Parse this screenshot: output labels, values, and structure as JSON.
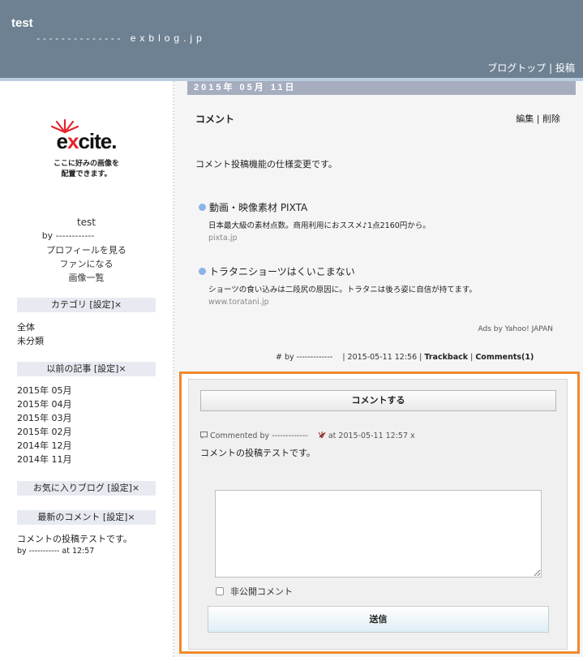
{
  "header": {
    "title": "test",
    "subtitle_dashes": "--------------",
    "domain": "exblog.jp",
    "link_top": "ブログトップ",
    "separator": "|",
    "link_post": "投稿"
  },
  "sidebar": {
    "logo_text_pre": "e",
    "logo_text_x": "x",
    "logo_text_post": "cite.",
    "logo_caption_1": "ここに好みの画像を",
    "logo_caption_2": "配置できます。",
    "profile_name": "test",
    "profile_by": "by   ------------",
    "profile_view": "プロフィールを見る",
    "become_fan": "ファンになる",
    "image_list": "画像一覧",
    "category_head": "カテゴリ [設定]×",
    "categories": [
      "全体",
      "未分類"
    ],
    "archive_head": "以前の記事 [設定]×",
    "archives": [
      "2015年 05月",
      "2015年 04月",
      "2015年 03月",
      "2015年 02月",
      "2014年 12月",
      "2014年 11月"
    ],
    "favorites_head": "お気に入りブログ [設定]×",
    "recent_comments_head": "最新のコメント [設定]×",
    "recent_comment_text": "コメントの投稿テストです。",
    "recent_comment_by": "by     -----------     at 12:57"
  },
  "post": {
    "date": "2015年 05月 11日",
    "title": "コメント",
    "edit": "編集",
    "action_sep": "|",
    "delete": "削除",
    "body": "コメント投稿機能の仕様変更です。",
    "ads": [
      {
        "title": "動画・映像素材 PIXTA",
        "desc": "日本最大級の素材点数。商用利用におススメ♪1点2160円から。",
        "url": "pixta.jp"
      },
      {
        "title": "トラタニショーツはくいこまない",
        "desc": "ショーツの食い込みは二段尻の原因に。トラタニは後ろ姿に自信が持てます。",
        "url": "www.toratani.jp"
      }
    ],
    "ads_by": "Ads by Yahoo! JAPAN",
    "meta_prefix": "# by   -------------",
    "meta_time": "| 2015-05-11 12:56 |",
    "trackback": "Trackback",
    "meta_sep": "|",
    "comments_link": "Comments(1)"
  },
  "comments": {
    "comment_button": "コメントする",
    "commented_by": "Commented by   -------------",
    "commented_at": "at 2015-05-11 12:57 x",
    "comment_body": "コメントの投稿テストです。",
    "textarea_value": "",
    "private_label": "非公開コメント",
    "submit_label": "送信"
  },
  "colors": {
    "header_bg": "#6e8193",
    "date_bar_bg": "#a6adbf",
    "highlight_border": "#f08a2c"
  }
}
